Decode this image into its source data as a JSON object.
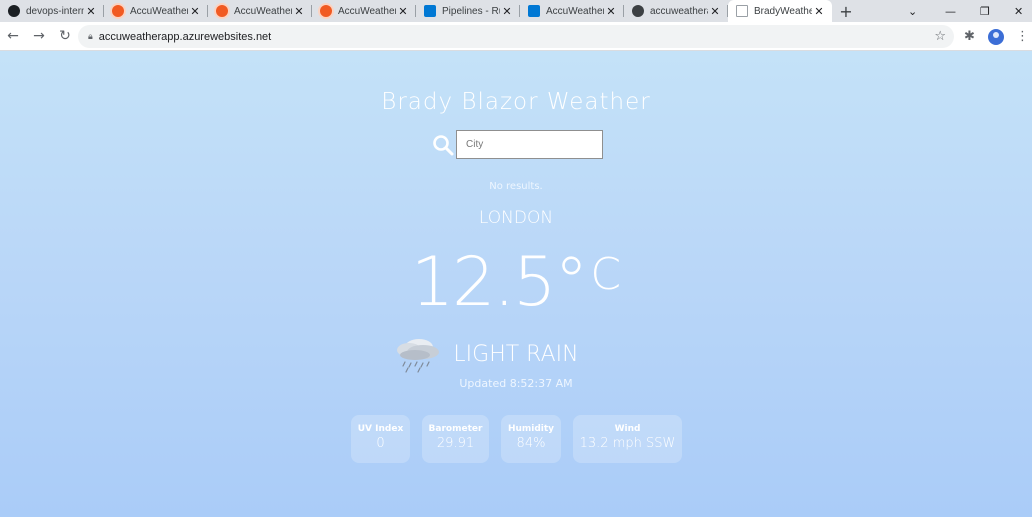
{
  "browser": {
    "tabs": [
      {
        "title": "devops-intern",
        "favicon": "github-icon"
      },
      {
        "title": "AccuWeather",
        "favicon": "accuweather-icon"
      },
      {
        "title": "AccuWeather",
        "favicon": "accuweather-icon"
      },
      {
        "title": "AccuWeather",
        "favicon": "accuweather-icon"
      },
      {
        "title": "Pipelines - Ru",
        "favicon": "azure-devops-icon"
      },
      {
        "title": "AccuWeather",
        "favicon": "azure-devops-icon"
      },
      {
        "title": "accuweathera",
        "favicon": "globe-icon"
      },
      {
        "title": "BradyWeathe",
        "favicon": "document-icon",
        "active": true
      }
    ],
    "url": "accuweatherapp.azurewebsites.net"
  },
  "app": {
    "title": "Brady Blazor Weather",
    "search": {
      "placeholder": "City",
      "value": ""
    },
    "no_results": "No results.",
    "city": "LONDON",
    "temperature": "12.5°",
    "unit": "C",
    "condition": "LIGHT RAIN",
    "condition_icon": "rain-cloud-icon",
    "updated": "Updated 8:52:37 AM",
    "stats": [
      {
        "label": "UV Index",
        "value": "0"
      },
      {
        "label": "Barometer",
        "value": "29.91"
      },
      {
        "label": "Humidity",
        "value": "84%"
      },
      {
        "label": "Wind",
        "value": "13.2 mph SSW"
      }
    ]
  },
  "colors": {
    "page_gradient_top": "#c4e2f8",
    "page_gradient_bottom": "#aaccf8",
    "text": "#ffffff",
    "tabstrip": "#dee1e6"
  }
}
